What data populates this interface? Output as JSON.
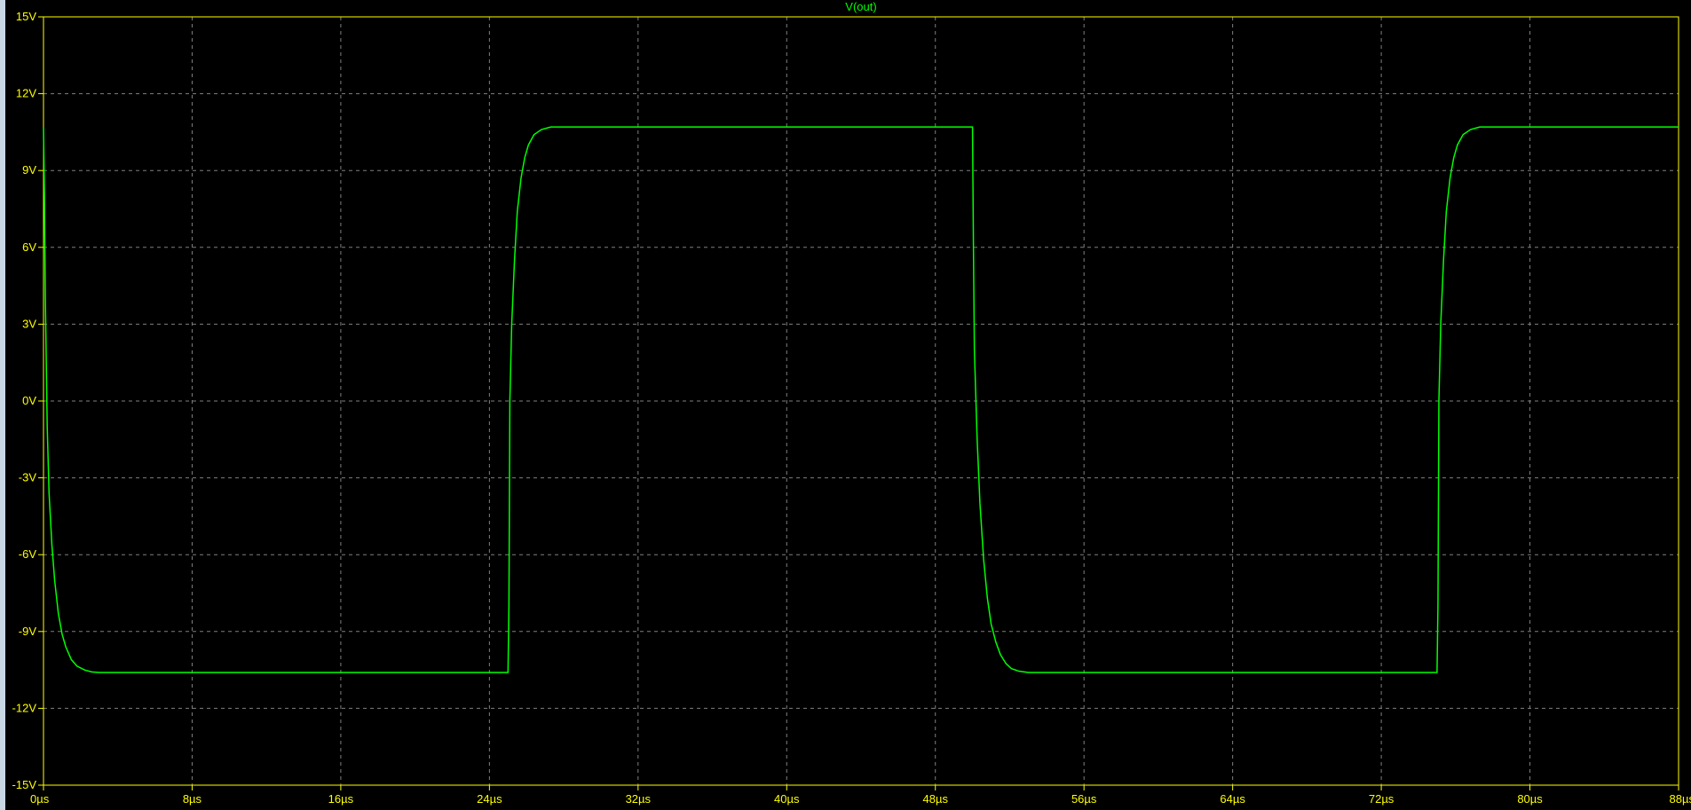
{
  "colors": {
    "background": "#000000",
    "axis": "#ffff00",
    "grid": "#808080",
    "trace": "#00ff00"
  },
  "chart_data": {
    "type": "line",
    "title": "V(out)",
    "xlabel": "",
    "ylabel": "",
    "xlim": [
      0,
      88
    ],
    "ylim": [
      -15,
      15
    ],
    "x_unit": "µs",
    "y_unit": "V",
    "grid": true,
    "x_ticks": [
      "0µs",
      "8µs",
      "16µs",
      "24µs",
      "32µs",
      "40µs",
      "48µs",
      "56µs",
      "64µs",
      "72µs",
      "80µs",
      "88µs"
    ],
    "y_ticks": [
      "15V",
      "12V",
      "9V",
      "6V",
      "3V",
      "0V",
      "-3V",
      "-6V",
      "-9V",
      "-12V",
      "-15V"
    ],
    "x_tick_values": [
      0,
      8,
      16,
      24,
      32,
      40,
      48,
      56,
      64,
      72,
      80,
      88
    ],
    "y_tick_values": [
      15,
      12,
      9,
      6,
      3,
      0,
      -3,
      -6,
      -9,
      -12,
      -15
    ],
    "series": [
      {
        "name": "V(out)",
        "x": [
          0,
          0.05,
          0.1,
          0.2,
          0.3,
          0.45,
          0.6,
          0.8,
          1.0,
          1.2,
          1.5,
          1.8,
          2.2,
          2.6,
          3.0,
          3.5,
          5.0,
          15.0,
          25.0,
          25.05,
          25.1,
          25.2,
          25.35,
          25.5,
          25.7,
          25.9,
          26.1,
          26.4,
          26.8,
          27.3,
          28.0,
          38.0,
          50.0,
          50.05,
          50.1,
          50.25,
          50.4,
          50.6,
          50.8,
          51.0,
          51.25,
          51.5,
          51.8,
          52.1,
          52.5,
          53.0,
          53.5,
          54.5,
          65.0,
          75.0,
          75.05,
          75.1,
          75.2,
          75.35,
          75.5,
          75.7,
          75.9,
          76.1,
          76.4,
          76.8,
          77.3,
          78.0,
          88.0
        ],
        "y": [
          10.7,
          8.0,
          4.0,
          -1.0,
          -3.6,
          -5.6,
          -7.0,
          -8.3,
          -9.1,
          -9.6,
          -10.1,
          -10.35,
          -10.5,
          -10.58,
          -10.6,
          -10.6,
          -10.6,
          -10.6,
          -10.6,
          -8.0,
          0.0,
          3.0,
          5.5,
          7.4,
          8.7,
          9.5,
          10.0,
          10.4,
          10.6,
          10.7,
          10.7,
          10.7,
          10.7,
          6.0,
          2.0,
          -1.5,
          -4.0,
          -6.2,
          -7.7,
          -8.7,
          -9.4,
          -9.9,
          -10.25,
          -10.45,
          -10.55,
          -10.6,
          -10.6,
          -10.6,
          -10.6,
          -10.6,
          -8.0,
          0.0,
          3.0,
          5.5,
          7.4,
          8.7,
          9.5,
          10.0,
          10.4,
          10.6,
          10.7,
          10.7,
          10.7
        ]
      }
    ]
  }
}
